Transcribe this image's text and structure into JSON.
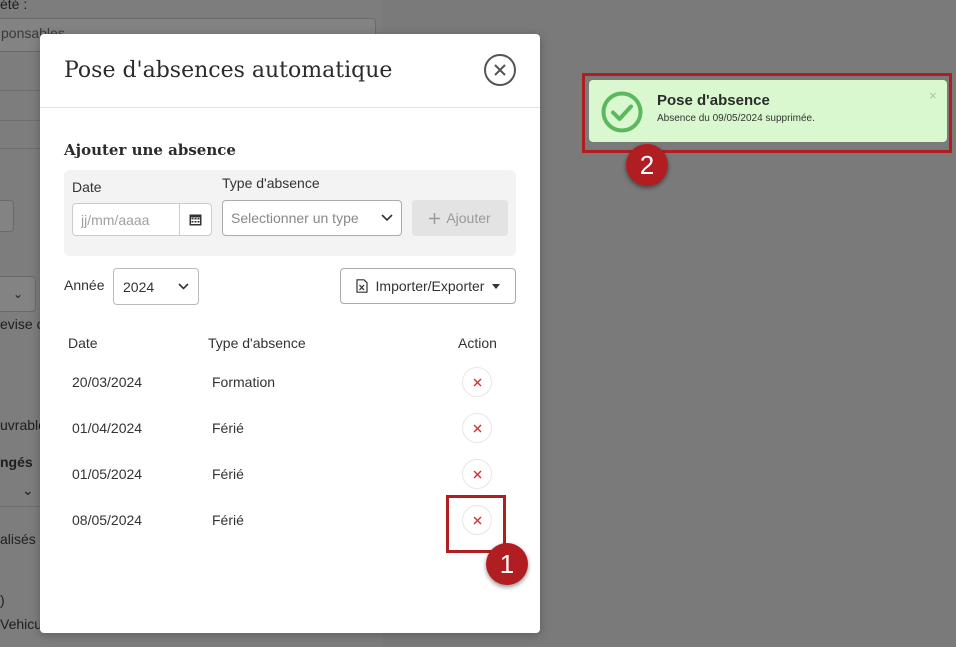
{
  "background": {
    "fragments": [
      "été :",
      "ponsables",
      "evise c",
      "uvrable",
      "ngés",
      "alisés",
      ")",
      "Vehicu"
    ]
  },
  "modal": {
    "title": "Pose d'absences automatique",
    "add_section": {
      "title": "Ajouter une absence",
      "date_label": "Date",
      "date_placeholder": "jj/mm/aaaa",
      "type_label": "Type d'absence",
      "type_placeholder": "Selectionner un type",
      "add_button": "Ajouter"
    },
    "year_label": "Année",
    "year_value": "2024",
    "import_export_button": "Importer/Exporter",
    "table": {
      "headers": [
        "Date",
        "Type d'absence",
        "Action"
      ],
      "rows": [
        {
          "date": "20/03/2024",
          "type": "Formation"
        },
        {
          "date": "01/04/2024",
          "type": "Férié"
        },
        {
          "date": "01/05/2024",
          "type": "Férié"
        },
        {
          "date": "08/05/2024",
          "type": "Férié"
        }
      ]
    }
  },
  "toast": {
    "title": "Pose d'absence",
    "message": "Absence du 09/05/2024 supprimée.",
    "close": "×"
  },
  "annotations": {
    "badge_1": "1",
    "badge_2": "2"
  },
  "colors": {
    "accent_red": "#b11e22",
    "delete_icon": "#d0312d",
    "success_bg": "#d9f8cf",
    "success_icon": "#5cb85c"
  }
}
